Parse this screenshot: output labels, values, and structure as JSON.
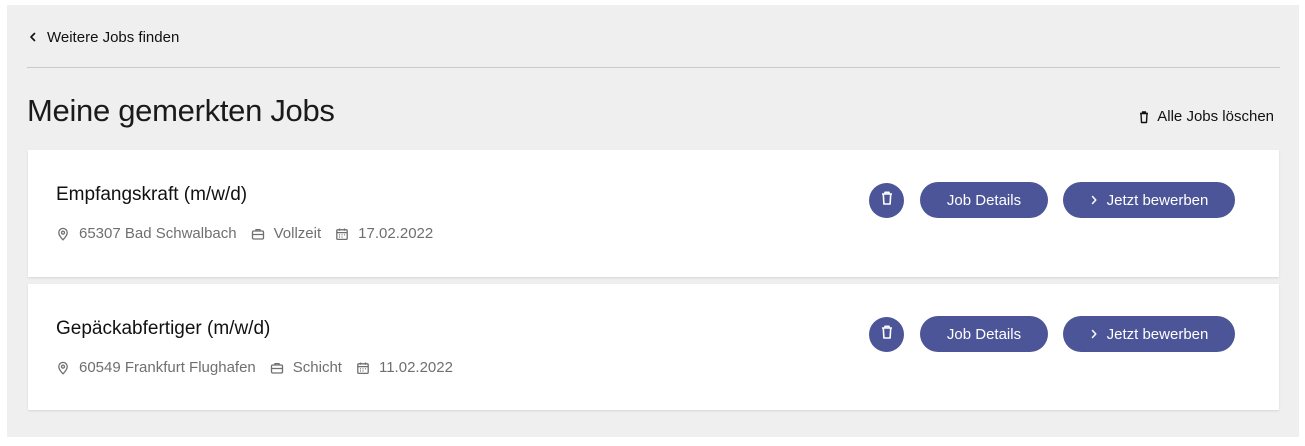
{
  "nav": {
    "back_label": "Weitere Jobs finden",
    "back_icon": "chevron-left-icon"
  },
  "header": {
    "title": "Meine gemerkten Jobs",
    "delete_all_label": "Alle Jobs löschen",
    "delete_all_icon": "trash-icon"
  },
  "jobs": [
    {
      "title": "Empfangskraft (m/w/d)",
      "location": "65307 Bad Schwalbach",
      "type": "Vollzeit",
      "date": "17.02.2022",
      "details_label": "Job Details",
      "apply_label": "Jetzt bewerben"
    },
    {
      "title": "Gepäckabfertiger (m/w/d)",
      "location": "60549 Frankfurt Flughafen",
      "type": "Schicht",
      "date": "11.02.2022",
      "details_label": "Job Details",
      "apply_label": "Jetzt bewerben"
    }
  ],
  "colors": {
    "accent": "#4b5597",
    "panel_background": "#efefef",
    "card_background": "#ffffff",
    "meta_text": "#6f6f6f"
  }
}
